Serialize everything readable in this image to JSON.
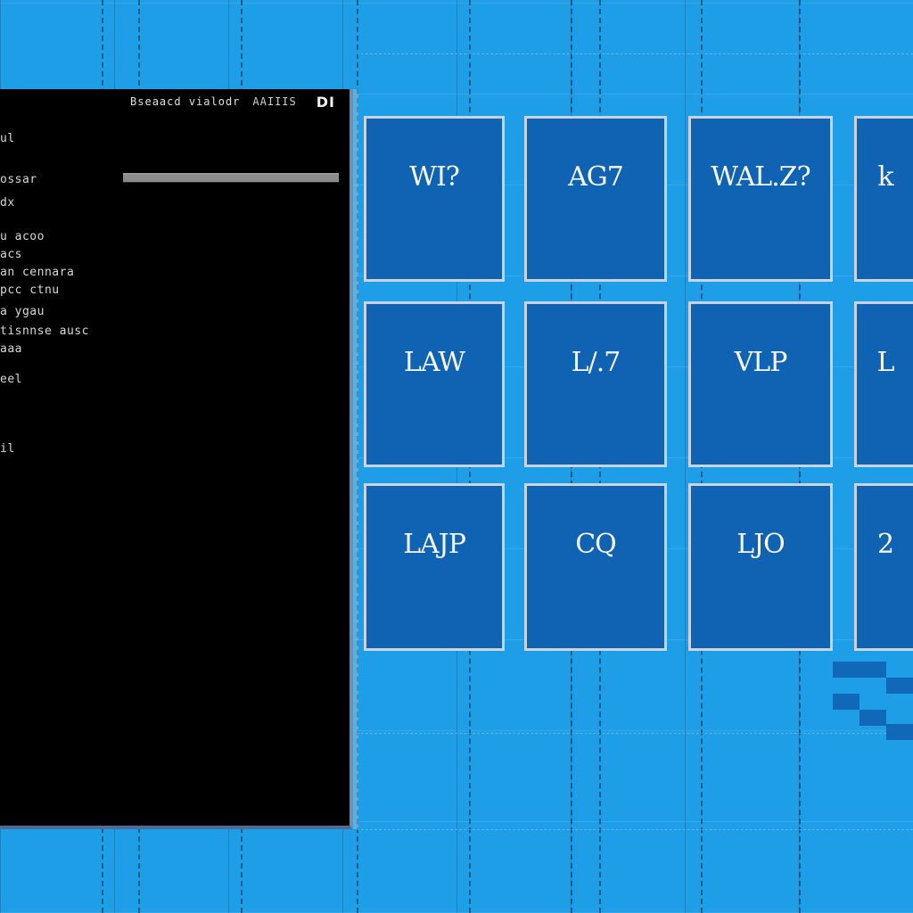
{
  "console": {
    "title": "Bseaacd vialodr",
    "title_extra": "AAIIIS",
    "logo_icon": "DI",
    "progress": 1.0,
    "lines": [
      "ul",
      "ossar",
      "dx",
      "u  acoo",
      "acs",
      "an cennara",
      "pcc  ctnu",
      "a ygau",
      "tisnnse ausc",
      "aaa",
      "eel",
      "il"
    ]
  },
  "tiles": [
    {
      "label": "WI?"
    },
    {
      "label": "AG7"
    },
    {
      "label": "WAL.Z?"
    },
    {
      "label": "k"
    },
    {
      "label": "LAW"
    },
    {
      "label": "L/.7"
    },
    {
      "label": "VLP"
    },
    {
      "label": "L"
    },
    {
      "label": "LAJP"
    },
    {
      "label": "CQ"
    },
    {
      "label": "LJO"
    },
    {
      "label": "2"
    }
  ],
  "colors": {
    "desktop": "#1e9ee6",
    "tile": "#1062b3",
    "tile_border": "#c9d3dd",
    "console_bg": "#000000"
  }
}
